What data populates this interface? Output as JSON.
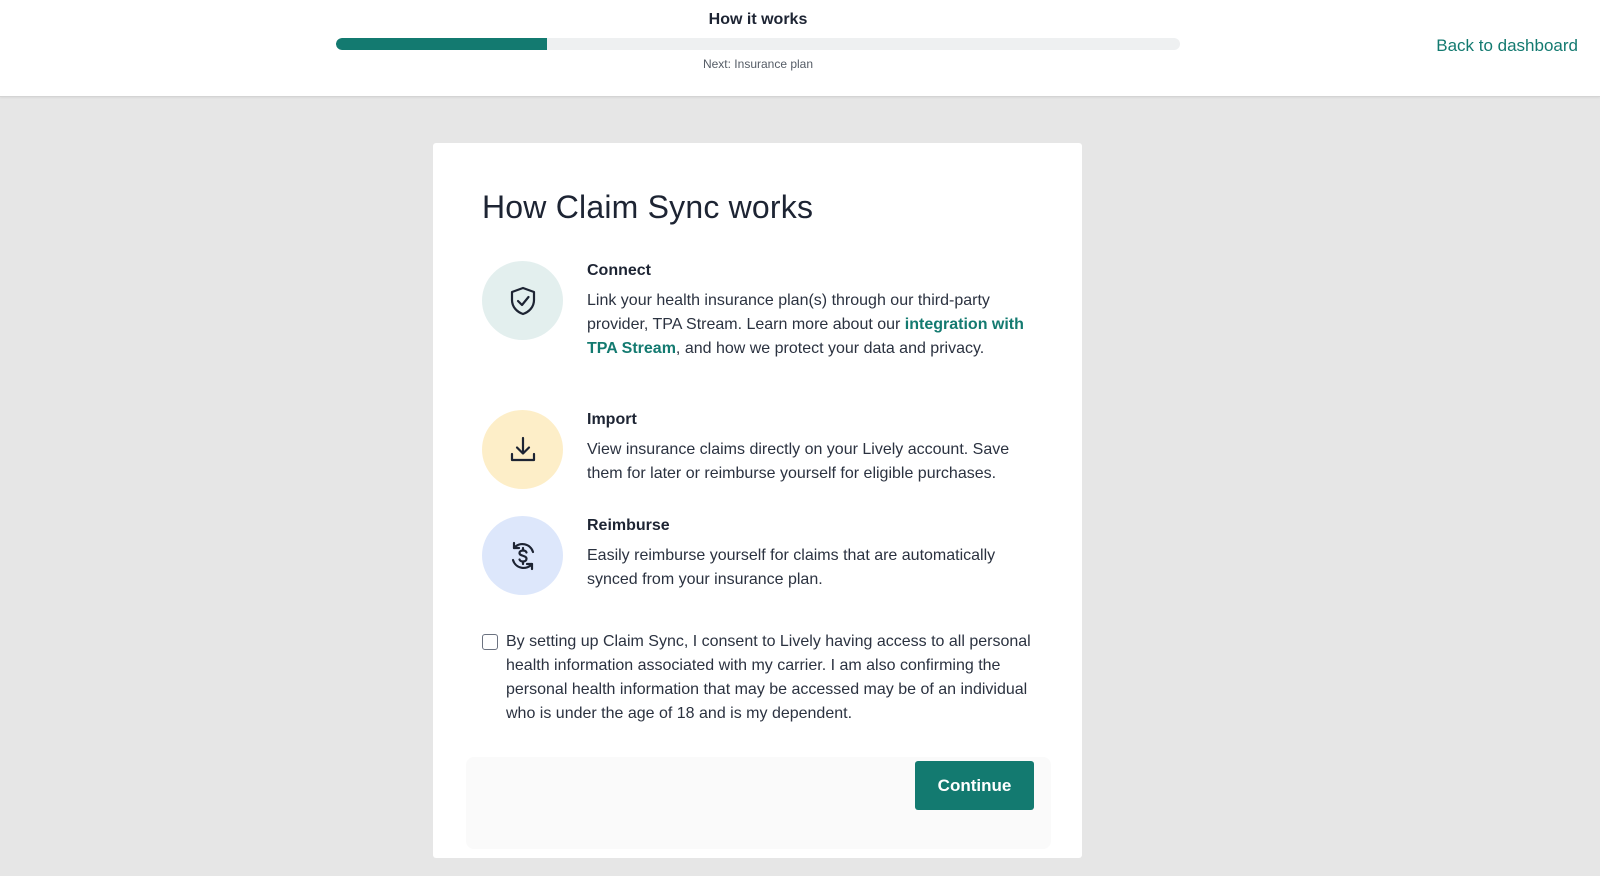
{
  "header": {
    "step_title": "How it works",
    "progress_percent": 25,
    "next_label": "Next: Insurance plan",
    "back_link": "Back to dashboard"
  },
  "card": {
    "title": "How Claim Sync works",
    "steps": [
      {
        "icon": "shield-check-icon",
        "icon_bg": "#e3efee",
        "heading": "Connect",
        "body_before": "Link your health insurance plan(s) through our third-party provider, TPA Stream. Learn more about our ",
        "link": "integration with TPA Stream",
        "body_after": ", and how we protect your data and privacy."
      },
      {
        "icon": "download-icon",
        "icon_bg": "#fdeec8",
        "heading": "Import",
        "body": "View insurance claims directly on your Lively account. Save them for later or reimburse yourself for eligible purchases."
      },
      {
        "icon": "dollar-sync-icon",
        "icon_bg": "#dde7fb",
        "heading": "Reimburse",
        "body": "Easily reimburse yourself for claims that are automatically synced from your insurance plan."
      }
    ],
    "consent_text": "By setting up Claim Sync, I consent to Lively having access to all personal health information associated with my carrier. I am also confirming the personal health information that may be accessed may be of an individual who is under the age of 18 and is my dependent.",
    "continue_label": "Continue"
  },
  "colors": {
    "brand": "#137a70",
    "page_bg": "#e6e6e6",
    "text": "#1d2433"
  }
}
